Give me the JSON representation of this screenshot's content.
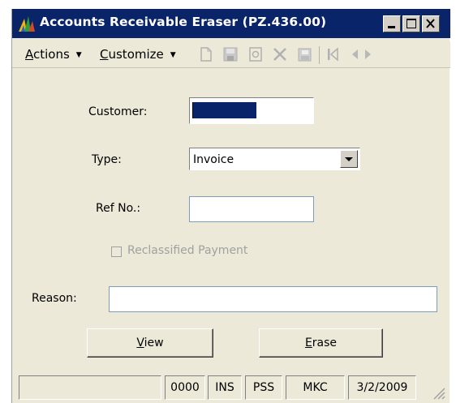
{
  "window": {
    "title": "Accounts Receivable Eraser (PZ.436.00)"
  },
  "toolbar": {
    "actions_letter": "A",
    "actions_rest": "ctions",
    "customize_letter": "C",
    "customize_rest": "ustomize"
  },
  "form": {
    "customer_label": "Customer:",
    "type_label": "Type:",
    "type_value": "Invoice",
    "refno_label": "Ref No.:",
    "refno_value": "",
    "reclassified_label": "Reclassified Payment",
    "reason_label": "Reason:",
    "reason_value": ""
  },
  "buttons": {
    "view_letter": "V",
    "view_rest": "iew",
    "erase_letter": "E",
    "erase_rest": "rase"
  },
  "status": {
    "panel1": "",
    "panel2": "0000",
    "panel3": "INS",
    "panel4": "PSS",
    "panel5": "MKC",
    "panel6": "3/2/2009"
  },
  "colors": {
    "titlebar": "#0a246a",
    "background": "#ece9d8",
    "selection": "#0a246a"
  }
}
